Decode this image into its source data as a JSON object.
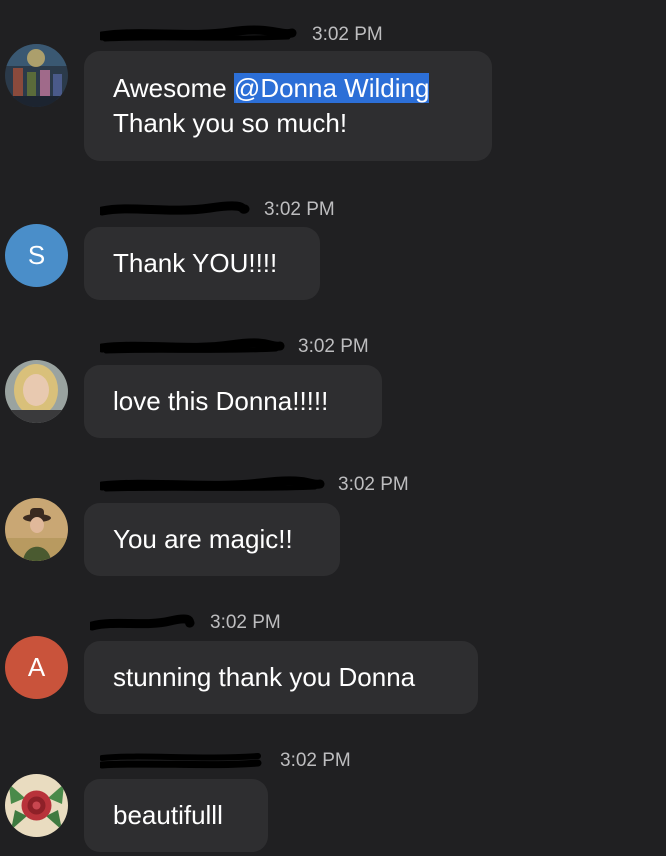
{
  "messages": [
    {
      "time": "3:02 PM",
      "avatar": {
        "kind": "image",
        "icon": "fantasy-art-avatar-icon"
      },
      "text_before": "Awesome ",
      "mention": "@Donna Wilding",
      "text_line2": "Thank you so much!"
    },
    {
      "time": "3:02 PM",
      "avatar": {
        "kind": "letter",
        "letter": "S",
        "color": "#4a8ec9"
      },
      "text": "Thank YOU!!!!"
    },
    {
      "time": "3:02 PM",
      "avatar": {
        "kind": "image",
        "icon": "blonde-woman-photo-avatar-icon"
      },
      "text": "love this Donna!!!!!"
    },
    {
      "time": "3:02 PM",
      "avatar": {
        "kind": "image",
        "icon": "woman-with-hat-photo-avatar-icon"
      },
      "text": "You are magic!!"
    },
    {
      "time": "3:02 PM",
      "avatar": {
        "kind": "letter",
        "letter": "A",
        "color": "#c9533b"
      },
      "text": "stunning thank you Donna"
    },
    {
      "time": "3:02 PM",
      "avatar": {
        "kind": "image",
        "icon": "rose-illustration-avatar-icon"
      },
      "text": "beautifulll"
    }
  ],
  "colors": {
    "background": "#202022",
    "bubble": "#2e2e30",
    "timestamp": "#bdbdbf",
    "mention_highlight": "#2c6fd7"
  }
}
